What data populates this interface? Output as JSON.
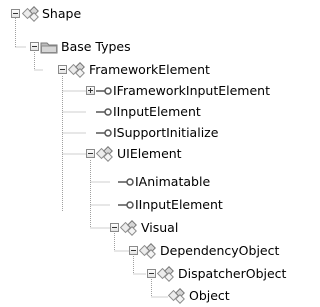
{
  "tree": {
    "nodes": [
      {
        "label": "Shape",
        "kind": "class-icon",
        "toggle": "expanded"
      },
      {
        "label": "Base Types",
        "kind": "folder-icon",
        "toggle": "expanded"
      },
      {
        "label": "FrameworkElement",
        "kind": "class-icon",
        "toggle": "expanded"
      },
      {
        "label": "IFrameworkInputElement",
        "kind": "interface-icon",
        "toggle": "collapsed"
      },
      {
        "label": "IInputElement",
        "kind": "interface-icon",
        "toggle": "none"
      },
      {
        "label": "ISupportInitialize",
        "kind": "interface-icon",
        "toggle": "none"
      },
      {
        "label": "UIElement",
        "kind": "class-icon",
        "toggle": "expanded"
      },
      {
        "label": "IAnimatable",
        "kind": "interface-icon",
        "toggle": "none"
      },
      {
        "label": "IInputElement",
        "kind": "interface-icon",
        "toggle": "none"
      },
      {
        "label": "Visual",
        "kind": "class-icon",
        "toggle": "expanded"
      },
      {
        "label": "DependencyObject",
        "kind": "class-icon",
        "toggle": "expanded"
      },
      {
        "label": "DispatcherObject",
        "kind": "class-icon",
        "toggle": "expanded"
      },
      {
        "label": "Object",
        "kind": "class-icon",
        "toggle": "none"
      }
    ]
  }
}
